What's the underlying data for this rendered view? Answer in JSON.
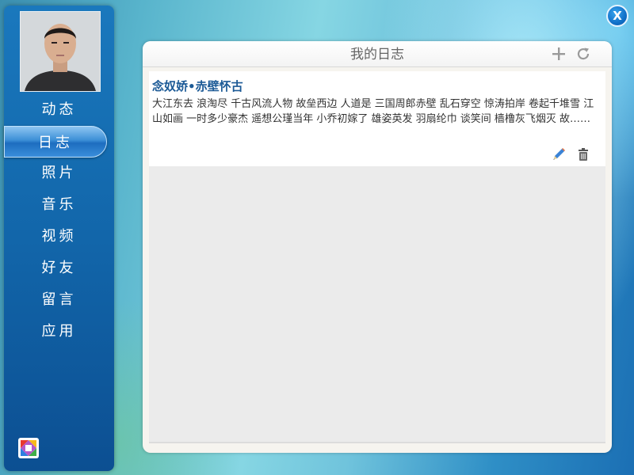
{
  "window": {
    "close_label": "X"
  },
  "sidebar": {
    "items": [
      {
        "label": "动态",
        "active": false
      },
      {
        "label": "日志",
        "active": true
      },
      {
        "label": "照片",
        "active": false
      },
      {
        "label": "音乐",
        "active": false
      },
      {
        "label": "视频",
        "active": false
      },
      {
        "label": "好友",
        "active": false
      },
      {
        "label": "留言",
        "active": false
      },
      {
        "label": "应用",
        "active": false
      }
    ],
    "bottom_icon": "picasa-app-icon"
  },
  "panel": {
    "title": "我的日志",
    "header_icons": [
      "add-icon",
      "refresh-icon"
    ],
    "entries": [
      {
        "title": "念奴娇•赤壁怀古",
        "excerpt": "大江东去 浪淘尽 千古风流人物 故垒西边 人道是 三国周郎赤壁 乱石穿空 惊涛拍岸 卷起千堆雪 江山如画 一时多少豪杰 遥想公瑾当年 小乔初嫁了 雄姿英发 羽扇纶巾 谈笑间 樯橹灰飞烟灭 故……",
        "actions": [
          "edit-icon",
          "trash-icon"
        ]
      }
    ]
  },
  "colors": {
    "sidebar_top": "#1a78bd",
    "sidebar_bottom": "#0c4f92",
    "active_tab": "#3c8fd6",
    "entry_title": "#1c5a96",
    "panel_bg": "#f6f4ef"
  }
}
